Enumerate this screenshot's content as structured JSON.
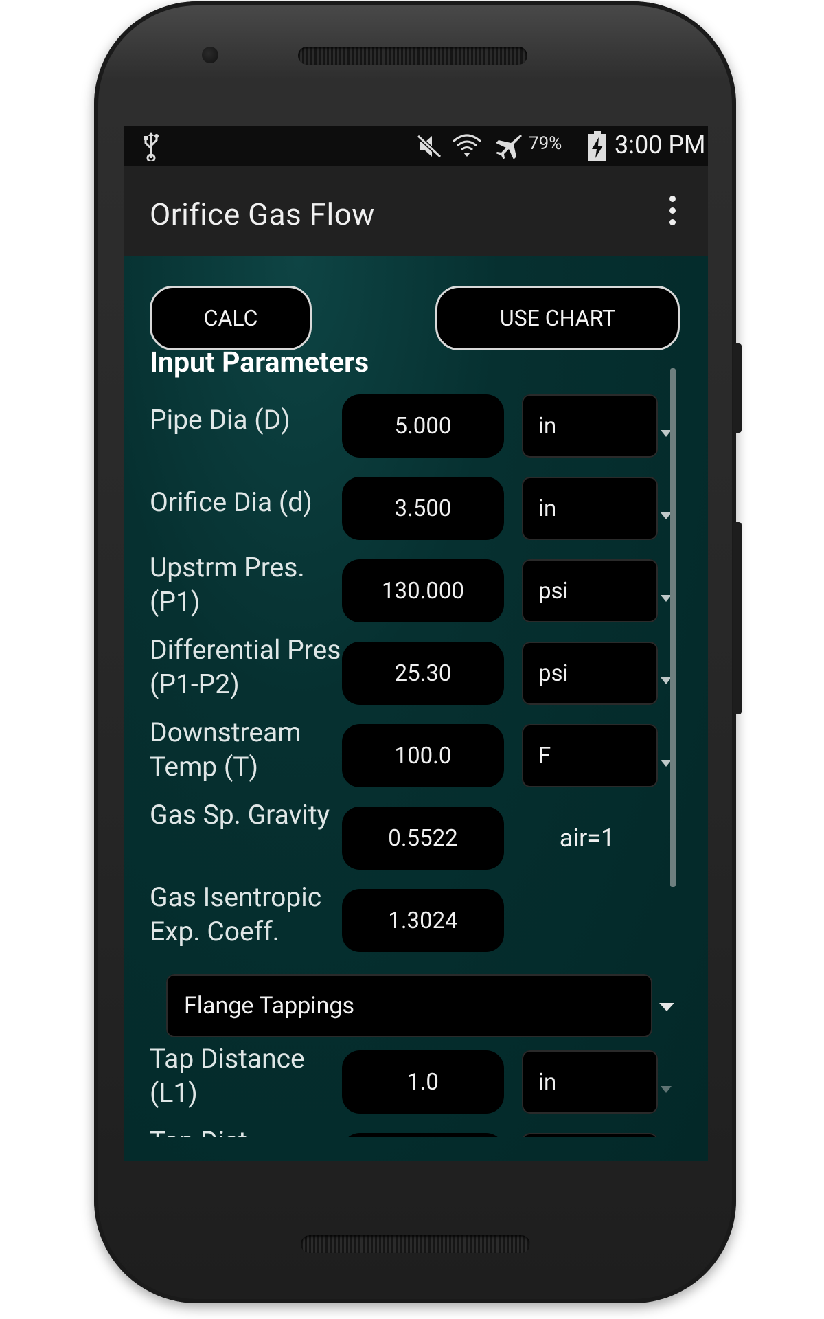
{
  "status_bar": {
    "icons": [
      "usb-icon",
      "mute-icon",
      "wifi-icon",
      "airplane-icon",
      "battery-charging-icon"
    ],
    "battery": "79%",
    "time": "3:00 PM"
  },
  "app_bar": {
    "title": "Orifice Gas Flow",
    "menu_icon": "overflow-menu-icon"
  },
  "buttons": {
    "calc": "CALC",
    "use_chart": "USE CHART"
  },
  "section_title": "Input Parameters",
  "parameters": [
    {
      "label": "Pipe Dia (D)",
      "value": "5.000",
      "unit": "in"
    },
    {
      "label": "Orifice Dia (d)",
      "value": "3.500",
      "unit": "in"
    },
    {
      "label": "Upstrm Pres. (P1)",
      "value": "130.000",
      "unit": "psi"
    },
    {
      "label": "Differential Pres. (P1-P2)",
      "value": "25.30",
      "unit": "psi"
    },
    {
      "label": "Downstream Temp (T)",
      "value": "100.0",
      "unit": "F"
    },
    {
      "label": "Gas Sp. Gravity",
      "value": "0.5522",
      "unit": "air=1"
    },
    {
      "label": "Gas Isentropic Exp. Coeff.",
      "value": "1.3024"
    }
  ],
  "tapping_type": "Flange Tappings",
  "tap_params": [
    {
      "label": "Tap Distance (L1)",
      "value": "1.0",
      "unit": "in"
    },
    {
      "label": "Tap Dist..."
    }
  ],
  "colors": {
    "screen_bg": "#042a2a",
    "action_bar": "#212121",
    "status_bar": "#0d0d0d",
    "field_bg": "#000000"
  }
}
